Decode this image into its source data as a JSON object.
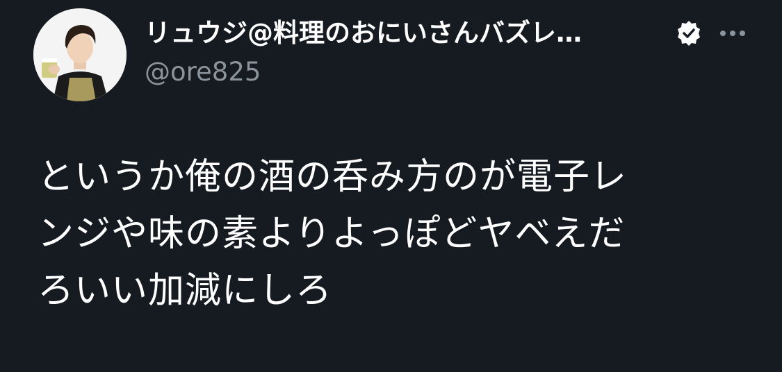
{
  "author": {
    "display_name": "リュウジ@料理のおにいさんバズレ…",
    "handle": "@ore825",
    "verified": true
  },
  "tweet": {
    "text_lines": [
      "というか俺の酒の呑み方のが電子レ",
      "ンジや味の素よりよっぽどヤベえだ",
      "ろいい加減にしろ"
    ]
  },
  "icons": {
    "verified": "verified-badge-icon",
    "more": "more-horizontal-icon"
  },
  "colors": {
    "background": "#161b22",
    "text": "#ffffff",
    "secondary_text": "#8b939c"
  }
}
